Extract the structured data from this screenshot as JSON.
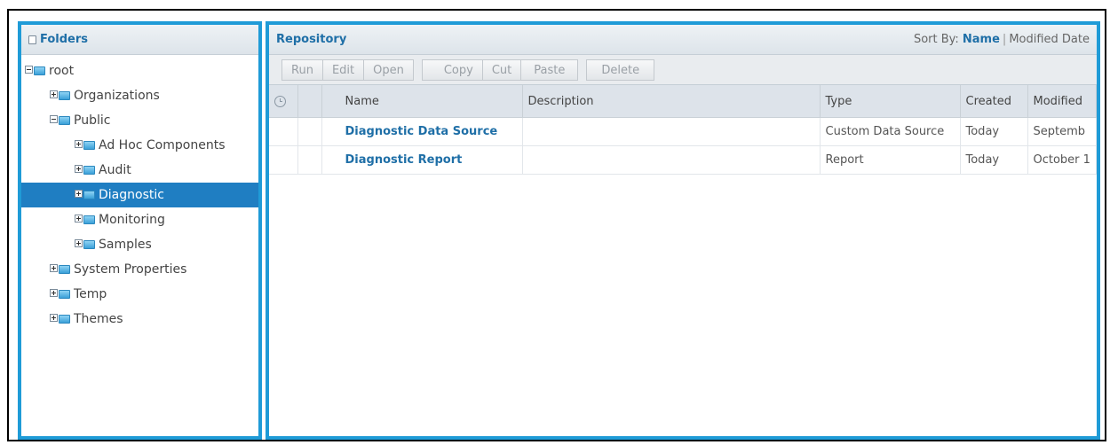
{
  "folders": {
    "title": "Folders",
    "tree": [
      {
        "label": "root",
        "expanded": true
      },
      {
        "label": "Organizations",
        "expanded": false
      },
      {
        "label": "Public",
        "expanded": true
      },
      {
        "label": "Ad Hoc Components",
        "expanded": false
      },
      {
        "label": "Audit",
        "expanded": false
      },
      {
        "label": "Diagnostic",
        "expanded": false,
        "selected": true
      },
      {
        "label": "Monitoring",
        "expanded": false
      },
      {
        "label": "Samples",
        "expanded": false
      },
      {
        "label": "System Properties",
        "expanded": false
      },
      {
        "label": "Temp",
        "expanded": false
      },
      {
        "label": "Themes",
        "expanded": false
      }
    ]
  },
  "repository": {
    "title": "Repository",
    "sort_by": {
      "label": "Sort By:",
      "active": "Name",
      "separator": "|",
      "other": "Modified Date"
    },
    "toolbar": {
      "run": "Run",
      "edit": "Edit",
      "open": "Open",
      "copy": "Copy",
      "cut": "Cut",
      "paste": "Paste",
      "delete": "Delete"
    },
    "columns": {
      "clock_icon": "clock-icon",
      "name": "Name",
      "description": "Description",
      "type": "Type",
      "created": "Created",
      "modified": "Modified"
    },
    "rows": [
      {
        "name": "Diagnostic Data Source",
        "description": "",
        "type": "Custom Data Source",
        "created": "Today",
        "modified": "Septemb"
      },
      {
        "name": "Diagnostic Report",
        "description": "",
        "type": "Report",
        "created": "Today",
        "modified": "October 1"
      }
    ]
  },
  "colors": {
    "accent": "#1f9bd7",
    "selected_bg": "#1f7ec2",
    "link": "#1f6fa7"
  }
}
